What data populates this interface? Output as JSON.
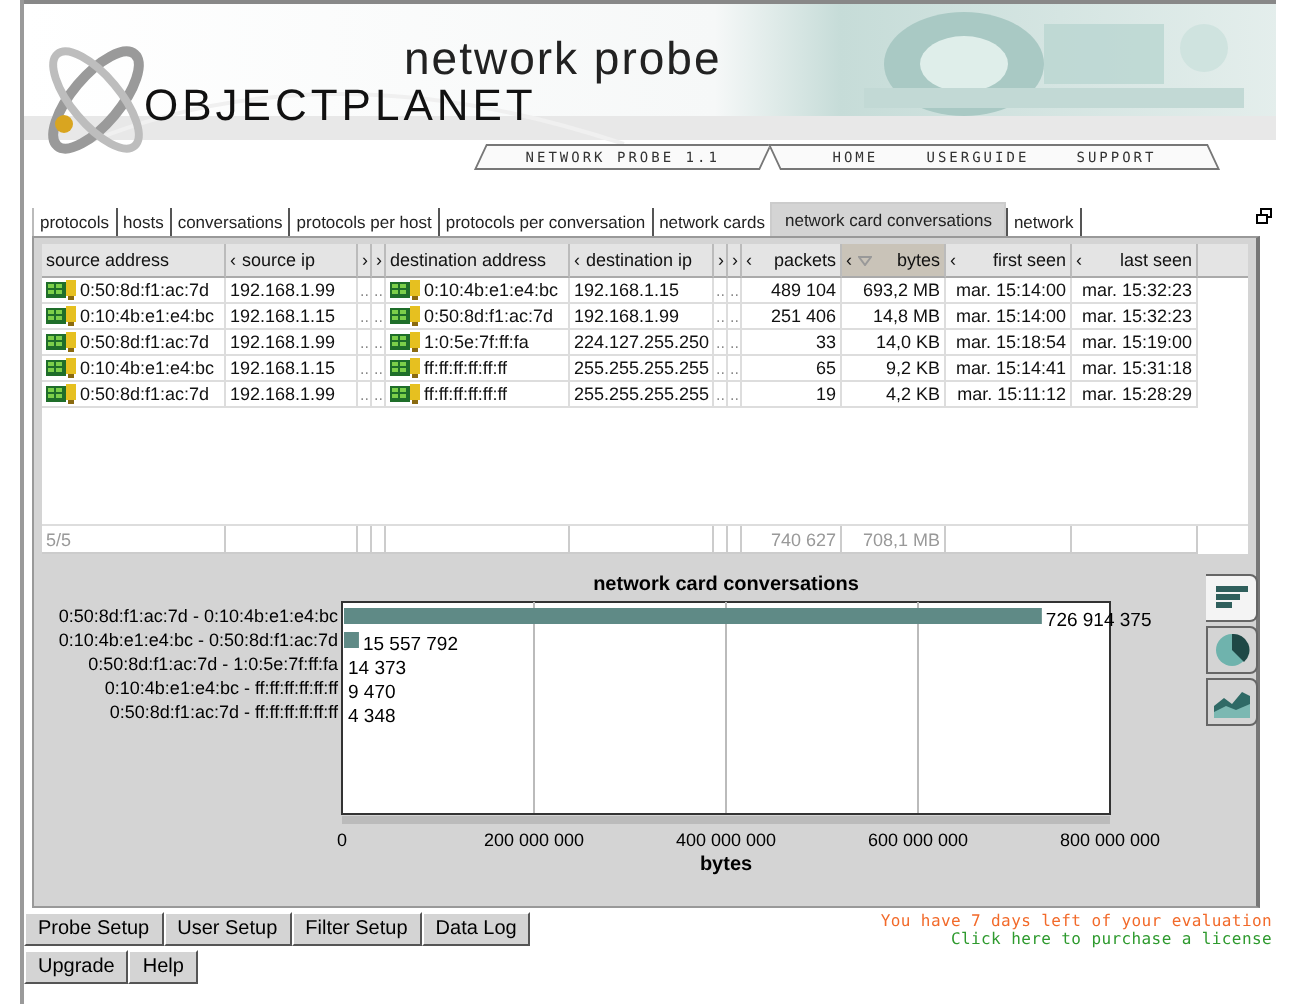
{
  "header": {
    "product": "network probe",
    "company": "OBJECTPLANET",
    "nav": [
      {
        "label": "NETWORK PROBE 1.1"
      },
      {
        "label": "HOME"
      },
      {
        "label": "USERGUIDE"
      },
      {
        "label": "SUPPORT"
      }
    ]
  },
  "tabs": [
    {
      "label": "protocols",
      "selected": false
    },
    {
      "label": "hosts",
      "selected": false
    },
    {
      "label": "conversations",
      "selected": false
    },
    {
      "label": "protocols per host",
      "selected": false
    },
    {
      "label": "protocols per conversation",
      "selected": false
    },
    {
      "label": "network cards",
      "selected": false
    },
    {
      "label": "network card conversations",
      "selected": true
    },
    {
      "label": "network",
      "selected": false
    }
  ],
  "table": {
    "columns": [
      {
        "label": "source address",
        "kind": "address",
        "sorted": false,
        "total": "5/5"
      },
      {
        "label": "source ip",
        "arrow": "‹",
        "kind": "text",
        "sorted": false
      },
      {
        "label": "›",
        "kind": "narrow",
        "sorted": false
      },
      {
        "label": "›",
        "kind": "narrow",
        "sorted": false
      },
      {
        "label": "destination address",
        "kind": "address",
        "sorted": false
      },
      {
        "label": "destination ip",
        "arrow": "‹",
        "kind": "text",
        "sorted": false
      },
      {
        "label": "›",
        "kind": "narrow",
        "sorted": false
      },
      {
        "label": "›",
        "kind": "narrow",
        "sorted": false
      },
      {
        "label": "packets",
        "arrow": "‹",
        "kind": "number",
        "sorted": false,
        "total": "740 627"
      },
      {
        "label": "bytes",
        "arrow": "‹",
        "kind": "number",
        "sorted": true,
        "total": "708,1 MB"
      },
      {
        "label": "first seen",
        "arrow": "‹",
        "kind": "number",
        "sorted": false
      },
      {
        "label": "last seen",
        "arrow": "‹",
        "kind": "number",
        "sorted": false
      }
    ],
    "rows": [
      [
        "0:50:8d:f1:ac:7d",
        "192.168.1.99",
        "..",
        "..",
        "0:10:4b:e1:e4:bc",
        "192.168.1.15",
        "..",
        "..",
        "489 104",
        "693,2 MB",
        "mar. 15:14:00",
        "mar. 15:32:23"
      ],
      [
        "0:10:4b:e1:e4:bc",
        "192.168.1.15",
        "..",
        "..",
        "0:50:8d:f1:ac:7d",
        "192.168.1.99",
        "..",
        "..",
        "251 406",
        "14,8 MB",
        "mar. 15:14:00",
        "mar. 15:32:23"
      ],
      [
        "0:50:8d:f1:ac:7d",
        "192.168.1.99",
        "..",
        "..",
        "1:0:5e:7f:ff:fa",
        "224.127.255.250",
        "..",
        "..",
        "33",
        "14,0 KB",
        "mar. 15:18:54",
        "mar. 15:19:00"
      ],
      [
        "0:10:4b:e1:e4:bc",
        "192.168.1.15",
        "..",
        "..",
        "ff:ff:ff:ff:ff:ff",
        "255.255.255.255",
        "..",
        "..",
        "65",
        "9,2 KB",
        "mar. 15:14:41",
        "mar. 15:31:18"
      ],
      [
        "0:50:8d:f1:ac:7d",
        "192.168.1.99",
        "..",
        "..",
        "ff:ff:ff:ff:ff:ff",
        "255.255.255.255",
        "..",
        "..",
        "19",
        "4,2 KB",
        "mar. 15:11:12",
        "mar. 15:28:29"
      ]
    ]
  },
  "chart": {
    "chart_data": {
      "type": "bar",
      "orientation": "horizontal",
      "title": "network card conversations",
      "xlabel": "bytes",
      "categories": [
        "0:50:8d:f1:ac:7d - 0:10:4b:e1:e4:bc",
        "0:10:4b:e1:e4:bc - 0:50:8d:f1:ac:7d",
        "0:50:8d:f1:ac:7d - 1:0:5e:7f:ff:fa",
        "0:10:4b:e1:e4:bc - ff:ff:ff:ff:ff:ff",
        "0:50:8d:f1:ac:7d - ff:ff:ff:ff:ff:ff"
      ],
      "values": [
        726914375,
        15557792,
        14373,
        9470,
        4348
      ],
      "grid": true,
      "value_labels": [
        "726 914 375",
        "15 557 792",
        "14 373",
        "9 470",
        "4 348"
      ],
      "xlim": [
        0,
        800000000
      ],
      "xticks": [
        {
          "value": 0,
          "label": "0"
        },
        {
          "value": 200000000,
          "label": "200 000 000"
        },
        {
          "value": 400000000,
          "label": "400 000 000"
        },
        {
          "value": 600000000,
          "label": "600 000 000"
        },
        {
          "value": 800000000,
          "label": "800 000 000"
        }
      ]
    },
    "chart_types": [
      {
        "kind": "bar",
        "selected": true
      },
      {
        "kind": "pie",
        "selected": false
      },
      {
        "kind": "area",
        "selected": false
      }
    ]
  },
  "buttons": [
    [
      "Probe Setup",
      "User Setup",
      "Filter Setup",
      "Data Log"
    ],
    [
      "Upgrade",
      "Help"
    ]
  ],
  "evaluation": {
    "notice": "You have 7 days left of your evaluation",
    "link": "Click here to purchase a license"
  }
}
